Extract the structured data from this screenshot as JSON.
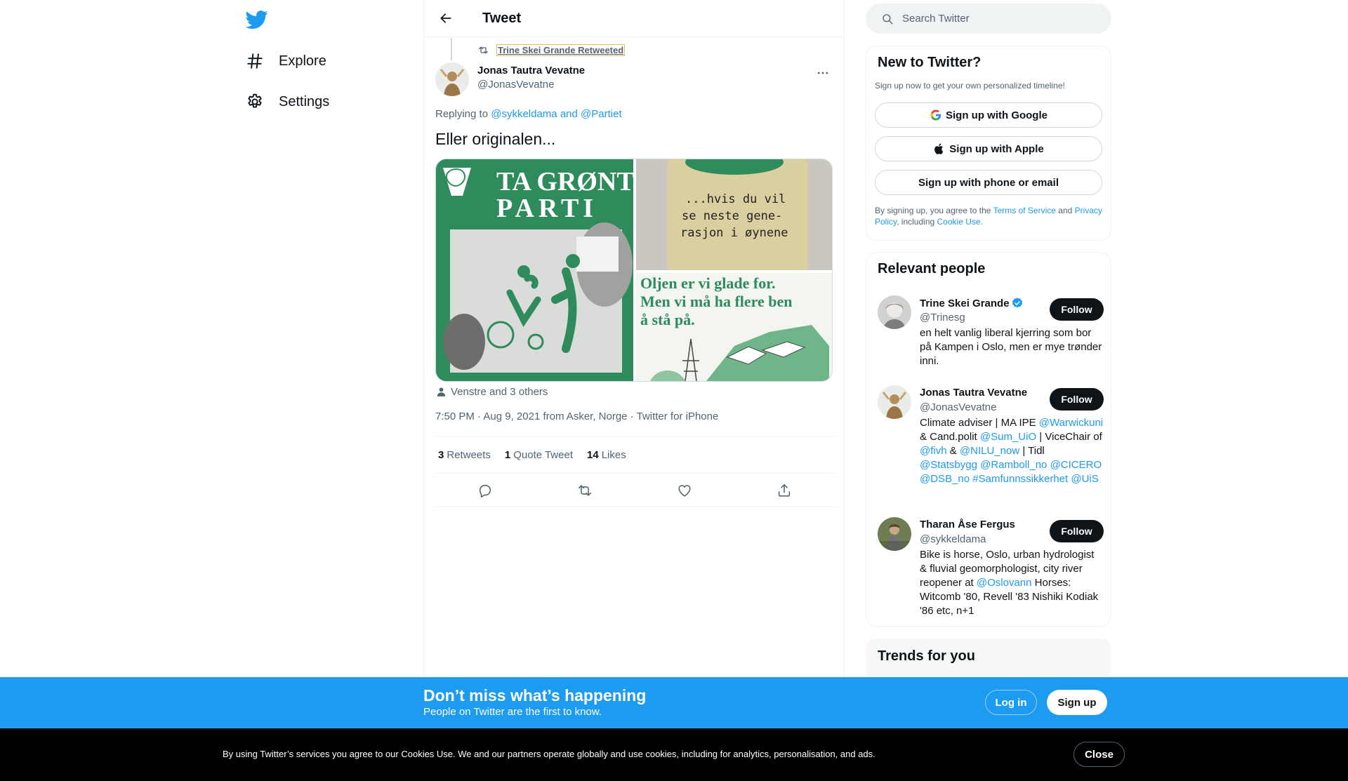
{
  "nav": {
    "explore_label": "Explore",
    "settings_label": "Settings"
  },
  "header": {
    "title": "Tweet"
  },
  "tweet": {
    "retweeted_by": "Trine Skei Grande Retweeted",
    "author_name": "Jonas Tautra Vevatne",
    "author_handle": "@JonasVevatne",
    "replying_prefix": "Replying to",
    "replying_user1": "@sykkeldama",
    "replying_and": "and",
    "replying_user2": "@Partiet",
    "text": "Eller originalen...",
    "image_left_headline1": "TA GRØNT",
    "image_left_headline2": "PARTI",
    "image_right_top_text1": "...hvis du vil",
    "image_right_top_text2": "se neste gene-",
    "image_right_top_text3": "rasjon i øynene",
    "image_right_bottom_text1": "Oljen er vi glade for.",
    "image_right_bottom_text2": "Men vi må ha flere ben",
    "image_right_bottom_text3": "å stå på.",
    "tagged": "Venstre and 3 others",
    "time": "7:50 PM",
    "date": "Aug 9, 2021",
    "location": "from Asker, Norge",
    "source": "Twitter for iPhone",
    "stats": {
      "retweets_count": "3",
      "retweets_label": "Retweets",
      "quotes_count": "1",
      "quotes_label": "Quote Tweet",
      "likes_count": "14",
      "likes_label": "Likes"
    }
  },
  "search": {
    "placeholder": "Search Twitter"
  },
  "new_to_twitter": {
    "title": "New to Twitter?",
    "subtitle": "Sign up now to get your own personalized timeline!",
    "google_label": "Sign up with Google",
    "apple_label": "Sign up with Apple",
    "phone_label": "Sign up with phone or email",
    "legal_prefix": "By signing up, you agree to the",
    "terms": "Terms of Service",
    "and": "and",
    "privacy": "Privacy Policy",
    "including": ", including",
    "cookie_use": "Cookie Use."
  },
  "relevant_people": {
    "title": "Relevant people",
    "follow_label": "Follow",
    "people": [
      {
        "name": "Trine Skei Grande",
        "handle": "@Trinesg",
        "bio": "en helt vanlig liberal kjerring som bor på Kampen i Oslo, men er mye trønder inni."
      },
      {
        "name": "Jonas Tautra Vevatne",
        "handle": "@JonasVevatne",
        "bio_1": "Climate adviser | MA IPE",
        "bio_2": "@Warwickuni",
        "bio_3": " & Cand.polit ",
        "bio_4": "@Sum_UiO",
        "bio_5": " | ViceChair of ",
        "bio_6": "@fivh",
        "bio_7": " & ",
        "bio_8": "@NILU_now",
        "bio_9": " | Tidl ",
        "bio_10": "@Statsbygg",
        "bio_11": "@Ramboll_no",
        "bio_12": "@CICERO",
        "bio_13": "@DSB_no",
        "bio_14": "#Samfunnssikkerhet",
        "bio_15": "@UiS"
      },
      {
        "name": "Tharan Åse Fergus",
        "handle": "@sykkeldama",
        "bio_1": "Bike is horse, Oslo, urban hydrologist & fluvial geomorphologist, city river reopener at ",
        "bio_2": "@Oslovann",
        "bio_3": " Horses: Witcomb '80, Revell '83 Nishiki Kodiak '86 etc, n+1"
      }
    ]
  },
  "trends": {
    "title": "Trends for you"
  },
  "banner": {
    "title": "Don’t miss what’s happening",
    "subtitle": "People on Twitter are the first to know.",
    "login_label": "Log in",
    "signup_label": "Sign up"
  },
  "cookie": {
    "text": "By using Twitter’s services you agree to our Cookies Use. We and our partners operate globally and use cookies, including for analytics, personalisation, and ads.",
    "close_label": "Close"
  },
  "colors": {
    "brand": "#1d9bf0",
    "text": "#0f1419",
    "secondary_text": "#536471",
    "border": "#eff3f4"
  }
}
